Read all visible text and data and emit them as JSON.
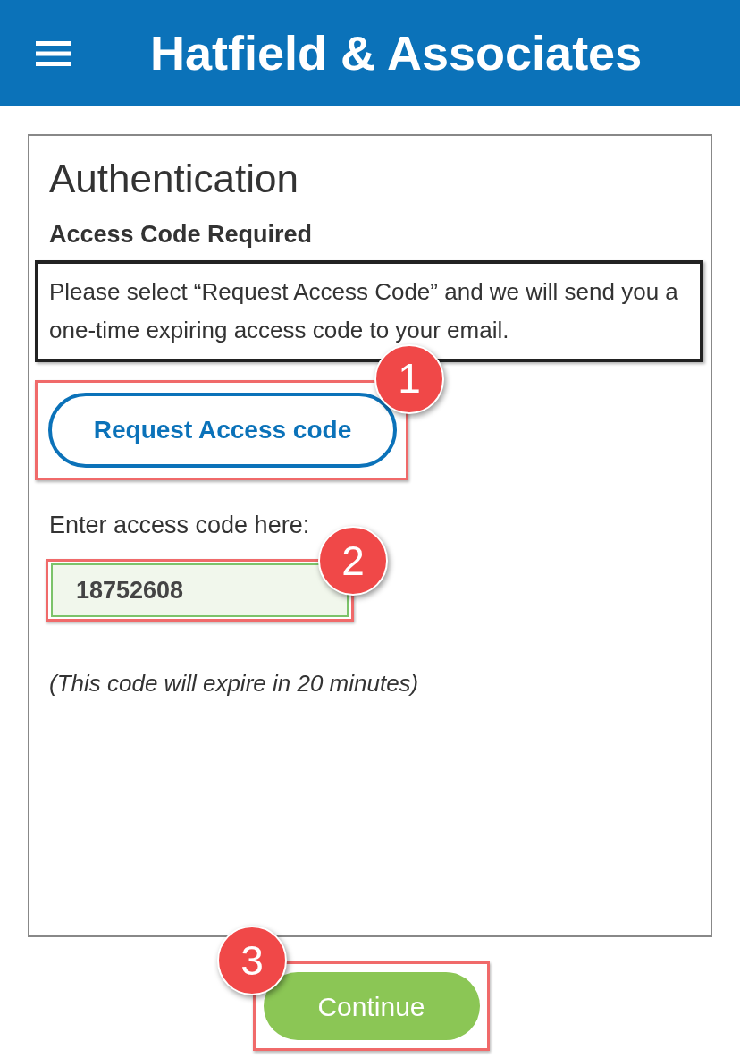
{
  "header": {
    "title": "Hatfield & Associates"
  },
  "card": {
    "heading": "Authentication",
    "subheading": "Access Code Required",
    "instructions": "Please select “Request Access Code” and we will send you a one-time expiring access code to your email.",
    "request_button": {
      "label": "Request Access code",
      "step": "1"
    },
    "code_field": {
      "label": "Enter access code here:",
      "value": "18752608",
      "step": "2"
    },
    "note": "(This code will expire in 20 minutes)"
  },
  "continue_button": {
    "label": "Continue",
    "step": "3"
  }
}
